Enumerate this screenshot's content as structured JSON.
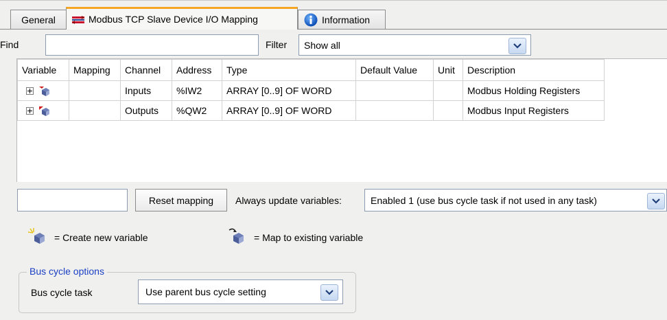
{
  "tabs": [
    {
      "label": "General",
      "active": false
    },
    {
      "label": "Modbus TCP Slave Device I/O Mapping",
      "active": true,
      "icon": "io-mapping-icon"
    },
    {
      "label": "Information",
      "active": false,
      "icon": "info-icon"
    }
  ],
  "find": {
    "label": "Find",
    "value": ""
  },
  "filter": {
    "label": "Filter",
    "selected": "Show all"
  },
  "table": {
    "columns": [
      "Variable",
      "Mapping",
      "Channel",
      "Address",
      "Type",
      "Default Value",
      "Unit",
      "Description"
    ],
    "rows": [
      {
        "variable": "",
        "mapping": "",
        "channel": "Inputs",
        "address": "%IW2",
        "type": "ARRAY [0..9] OF WORD",
        "default_value": "",
        "unit": "",
        "description": "Modbus Holding Registers"
      },
      {
        "variable": "",
        "mapping": "",
        "channel": "Outputs",
        "address": "%QW2",
        "type": "ARRAY [0..9] OF WORD",
        "default_value": "",
        "unit": "",
        "description": "Modbus Input Registers"
      }
    ]
  },
  "controls": {
    "mapping_input_value": "",
    "reset_mapping_label": "Reset mapping",
    "always_update_label": "Always update variables:",
    "always_update_selected": "Enabled 1 (use bus cycle task if not used in any task)"
  },
  "legend": {
    "create_new": "= Create new variable",
    "map_existing": "= Map to existing variable"
  },
  "bus_cycle": {
    "group_title": "Bus cycle options",
    "task_label": "Bus cycle task",
    "task_selected": "Use parent bus cycle setting"
  },
  "colors": {
    "active_tab_accent": "#f5a623",
    "group_title": "#1a3fc4",
    "dropdown_button": "#c6d8f1"
  }
}
